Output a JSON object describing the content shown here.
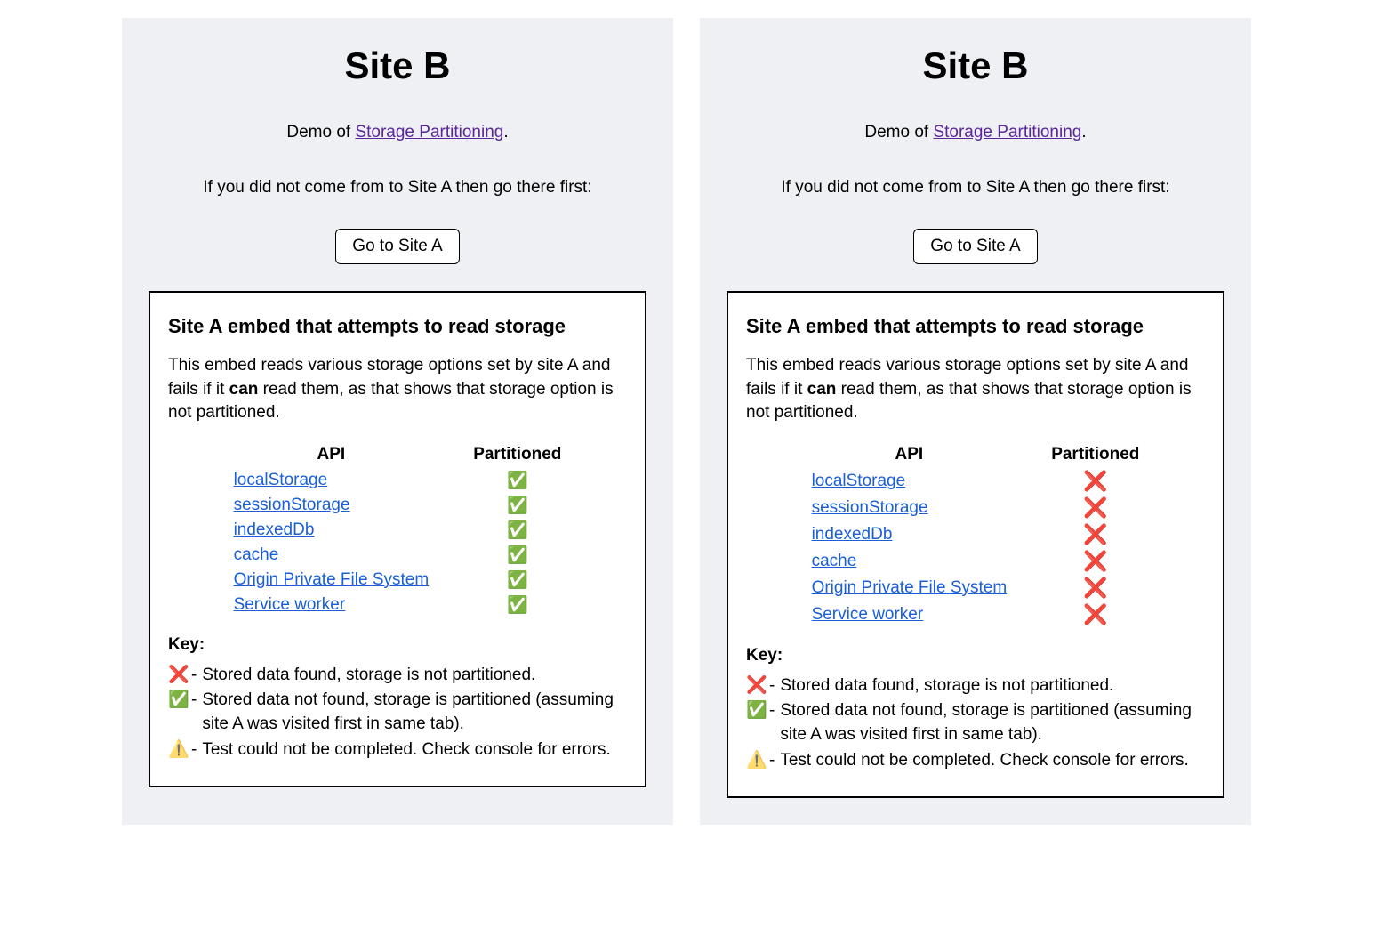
{
  "panels": [
    {
      "title": "Site B",
      "intro_prefix": "Demo of ",
      "intro_link": "Storage Partitioning",
      "intro_suffix": ".",
      "instruction": "If you did not come from to Site A then go there first:",
      "button_label": "Go to Site A",
      "embed": {
        "title": "Site A embed that attempts to read storage",
        "desc_part1": "This embed reads various storage options set by site A and fails if it ",
        "desc_strong": "can",
        "desc_part2": " read them, as that shows that storage option is not partitioned.",
        "table_header_api": "API",
        "table_header_status": "Partitioned",
        "rows": [
          {
            "label": "localStorage",
            "status": "pass"
          },
          {
            "label": "sessionStorage",
            "status": "pass"
          },
          {
            "label": "indexedDb",
            "status": "pass"
          },
          {
            "label": "cache",
            "status": "pass"
          },
          {
            "label": "Origin Private File System",
            "status": "pass"
          },
          {
            "label": "Service worker",
            "status": "pass"
          }
        ],
        "key_title": "Key:",
        "key_items": [
          {
            "icon": "x",
            "text": "Stored data found, storage is not partitioned."
          },
          {
            "icon": "check",
            "text": "Stored data not found, storage is partitioned (assuming site A was visited first in same tab)."
          },
          {
            "icon": "warn",
            "text": "Test could not be completed. Check console for errors."
          }
        ]
      }
    },
    {
      "title": "Site B",
      "intro_prefix": "Demo of ",
      "intro_link": "Storage Partitioning",
      "intro_suffix": ".",
      "instruction": "If you did not come from to Site A then go there first:",
      "button_label": "Go to Site A",
      "embed": {
        "title": "Site A embed that attempts to read storage",
        "desc_part1": "This embed reads various storage options set by site A and fails if it ",
        "desc_strong": "can",
        "desc_part2": " read them, as that shows that storage option is not partitioned.",
        "table_header_api": "API",
        "table_header_status": "Partitioned",
        "rows": [
          {
            "label": "localStorage",
            "status": "fail"
          },
          {
            "label": "sessionStorage",
            "status": "fail"
          },
          {
            "label": "indexedDb",
            "status": "fail"
          },
          {
            "label": "cache",
            "status": "fail"
          },
          {
            "label": "Origin Private File System",
            "status": "fail"
          },
          {
            "label": "Service worker",
            "status": "fail"
          }
        ],
        "key_title": "Key:",
        "key_items": [
          {
            "icon": "x",
            "text": "Stored data found, storage is not partitioned."
          },
          {
            "icon": "check",
            "text": "Stored data not found, storage is partitioned (assuming site A was visited first in same tab)."
          },
          {
            "icon": "warn",
            "text": "Test could not be completed. Check console for errors."
          }
        ]
      }
    }
  ],
  "icons": {
    "pass": "✅",
    "fail": "❌",
    "x": "❌",
    "check": "✅",
    "warn": "⚠️"
  }
}
